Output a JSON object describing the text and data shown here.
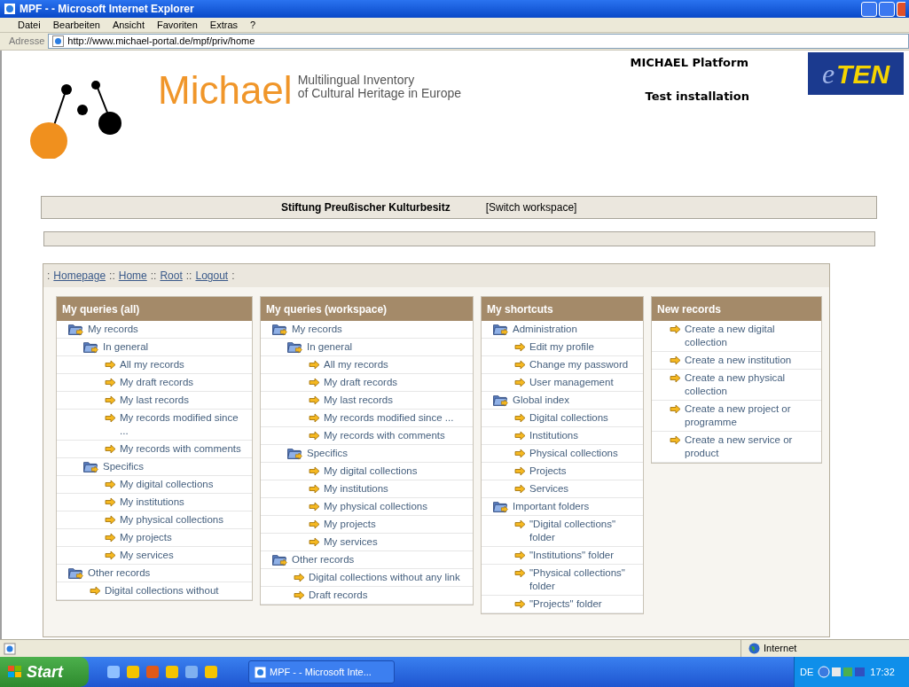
{
  "window": {
    "title": "MPF - - Microsoft Internet Explorer"
  },
  "menu": [
    "Datei",
    "Bearbeiten",
    "Ansicht",
    "Favoriten",
    "Extras",
    "?"
  ],
  "address": {
    "label": "Adresse",
    "url": "http://www.michael-portal.de/mpf/priv/home"
  },
  "header": {
    "logo_word": "Michael",
    "logo_subtitle": [
      "Multilingual Inventory",
      "of Cultural Heritage in Europe"
    ],
    "platform": "MICHAEL Platform",
    "installation": "Test installation",
    "eten": [
      "e",
      "TEN"
    ]
  },
  "workspace": {
    "name": "Stiftung Preußischer Kulturbesitz",
    "switch": "[Switch workspace]"
  },
  "breadcrumb": [
    {
      "kind": "sep",
      "text": ":"
    },
    {
      "kind": "link",
      "text": "Homepage"
    },
    {
      "kind": "sep",
      "text": "::"
    },
    {
      "kind": "link",
      "text": "Home"
    },
    {
      "kind": "sep",
      "text": "::"
    },
    {
      "kind": "link",
      "text": "Root"
    },
    {
      "kind": "sep",
      "text": "::"
    },
    {
      "kind": "link",
      "text": "Logout"
    },
    {
      "kind": "sep",
      "text": ":"
    }
  ],
  "columns": [
    {
      "title": "My queries (all)",
      "items": [
        {
          "kind": "folder",
          "label": "My records",
          "children": [
            {
              "kind": "folder",
              "label": "In general",
              "children": [
                {
                  "kind": "link",
                  "label": "All my records"
                },
                {
                  "kind": "link",
                  "label": "My draft records"
                },
                {
                  "kind": "link",
                  "label": "My last records"
                },
                {
                  "kind": "link",
                  "label": "My records modified since ..."
                },
                {
                  "kind": "link",
                  "label": "My records with comments"
                }
              ]
            },
            {
              "kind": "folder",
              "label": "Specifics",
              "children": [
                {
                  "kind": "link",
                  "label": "My digital collections"
                },
                {
                  "kind": "link",
                  "label": "My institutions"
                },
                {
                  "kind": "link",
                  "label": "My physical collections"
                },
                {
                  "kind": "link",
                  "label": "My projects"
                },
                {
                  "kind": "link",
                  "label": "My services"
                }
              ]
            }
          ]
        },
        {
          "kind": "folder",
          "label": "Other records",
          "children": [
            {
              "kind": "link",
              "label": "Digital collections without"
            }
          ]
        }
      ]
    },
    {
      "title": "My queries (workspace)",
      "items": [
        {
          "kind": "folder",
          "label": "My records",
          "children": [
            {
              "kind": "folder",
              "label": "In general",
              "children": [
                {
                  "kind": "link",
                  "label": "All my records"
                },
                {
                  "kind": "link",
                  "label": "My draft records"
                },
                {
                  "kind": "link",
                  "label": "My last records"
                },
                {
                  "kind": "link",
                  "label": "My records modified since ..."
                },
                {
                  "kind": "link",
                  "label": "My records with comments"
                }
              ]
            },
            {
              "kind": "folder",
              "label": "Specifics",
              "children": [
                {
                  "kind": "link",
                  "label": "My digital collections"
                },
                {
                  "kind": "link",
                  "label": "My institutions"
                },
                {
                  "kind": "link",
                  "label": "My physical collections"
                },
                {
                  "kind": "link",
                  "label": "My projects"
                },
                {
                  "kind": "link",
                  "label": "My services"
                }
              ]
            }
          ]
        },
        {
          "kind": "folder",
          "label": "Other records",
          "children": [
            {
              "kind": "link",
              "label": "Digital collections without any link"
            },
            {
              "kind": "link",
              "label": "Draft records"
            }
          ]
        }
      ]
    },
    {
      "title": "My shortcuts",
      "items": [
        {
          "kind": "folder",
          "label": "Administration",
          "children": [
            {
              "kind": "link",
              "label": "Edit my profile"
            },
            {
              "kind": "link",
              "label": "Change my password"
            },
            {
              "kind": "link",
              "label": "User management"
            }
          ]
        },
        {
          "kind": "folder",
          "label": "Global index",
          "children": [
            {
              "kind": "link",
              "label": "Digital collections"
            },
            {
              "kind": "link",
              "label": "Institutions"
            },
            {
              "kind": "link",
              "label": "Physical collections"
            },
            {
              "kind": "link",
              "label": "Projects"
            },
            {
              "kind": "link",
              "label": "Services"
            }
          ]
        },
        {
          "kind": "folder",
          "label": "Important folders",
          "children": [
            {
              "kind": "link",
              "label": "\"Digital collections\" folder"
            },
            {
              "kind": "link",
              "label": "\"Institutions\" folder"
            },
            {
              "kind": "link",
              "label": "\"Physical collections\" folder"
            },
            {
              "kind": "link",
              "label": "\"Projects\" folder"
            }
          ]
        }
      ]
    },
    {
      "title": "New records",
      "items": [
        {
          "kind": "link",
          "label": "Create a new digital collection"
        },
        {
          "kind": "link",
          "label": "Create a new institution"
        },
        {
          "kind": "link",
          "label": "Create a new physical collection"
        },
        {
          "kind": "link",
          "label": "Create a new project or programme"
        },
        {
          "kind": "link",
          "label": "Create a new service or product"
        }
      ]
    }
  ],
  "status_bar": {
    "zone": "Internet"
  },
  "taskbar": {
    "start": "Start",
    "window": "MPF - - Microsoft Inte...",
    "language": "DE",
    "clock": "17:32"
  }
}
